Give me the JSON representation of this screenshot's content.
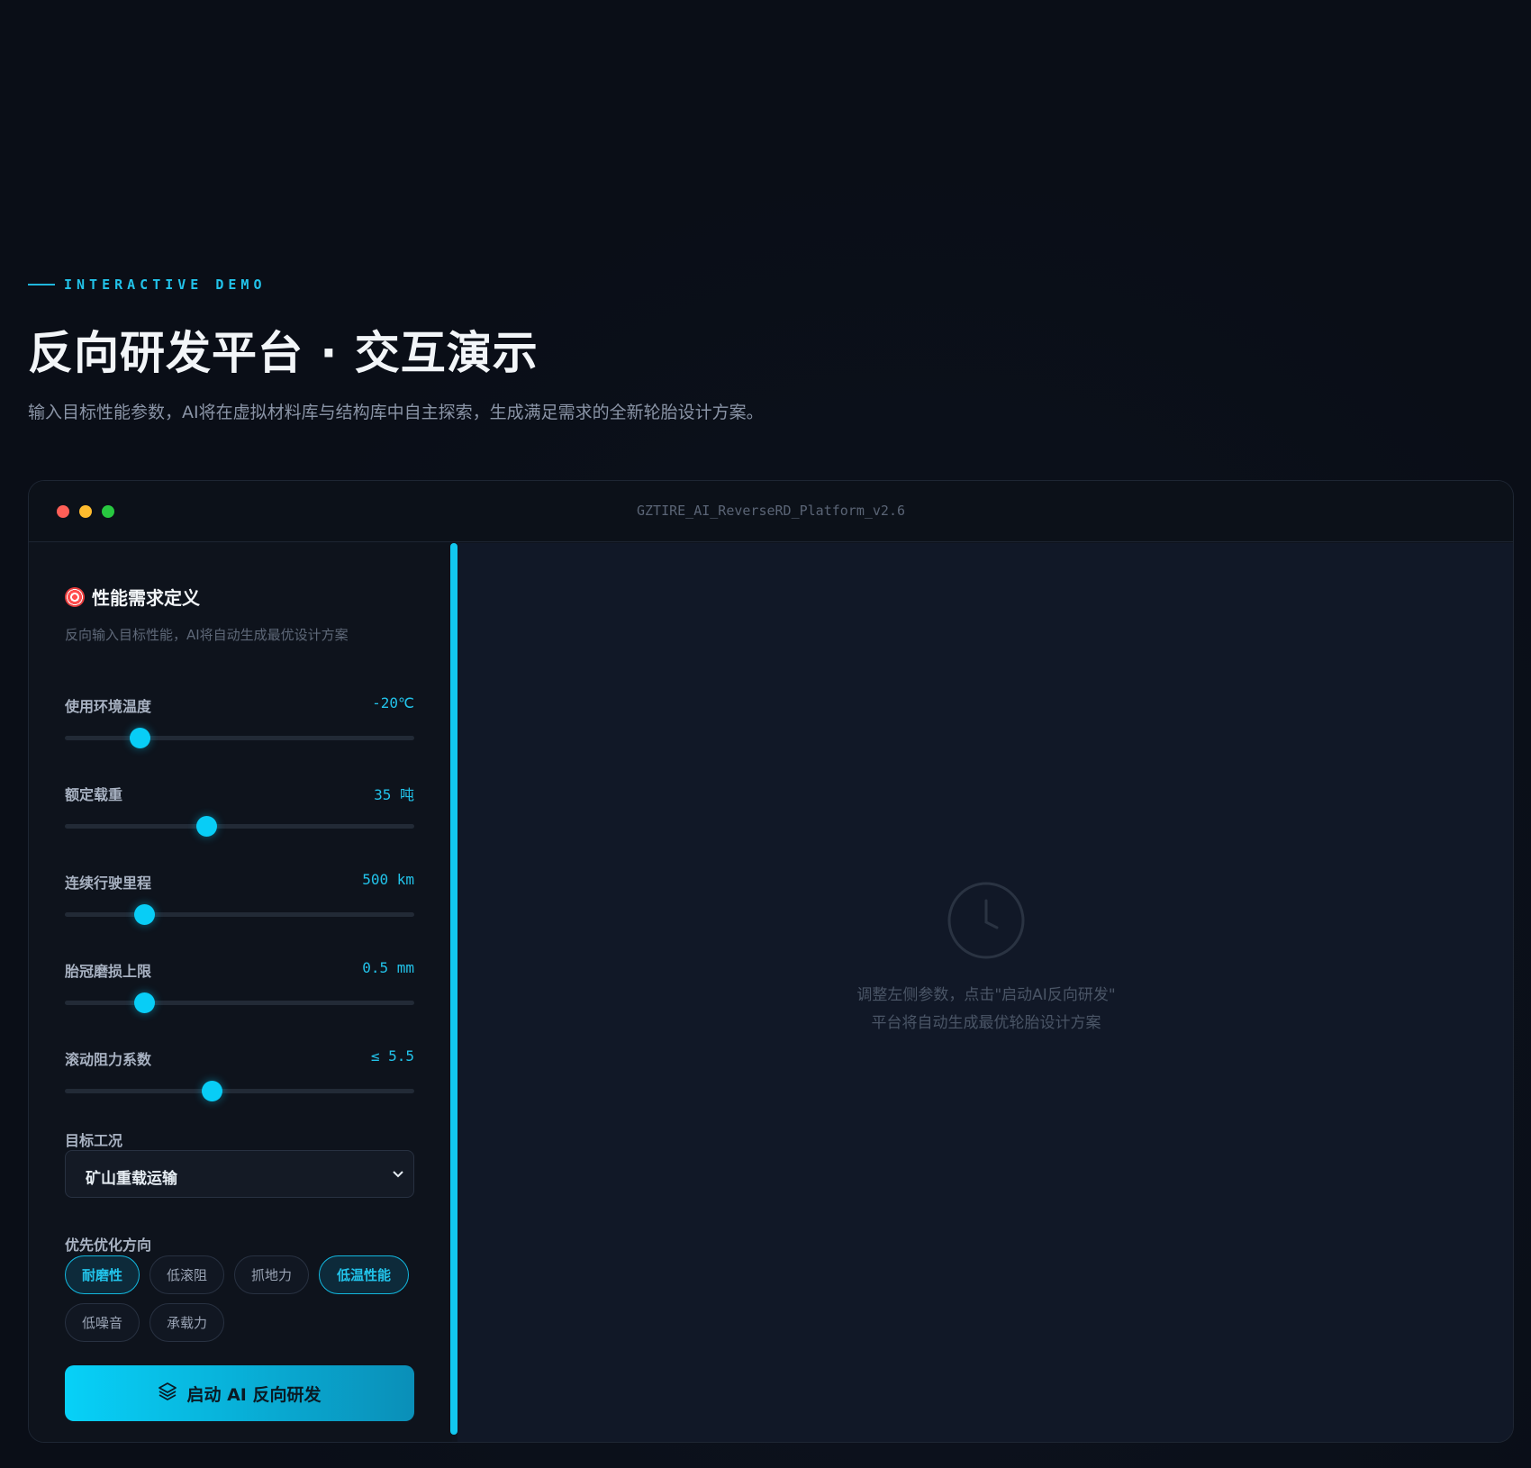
{
  "header": {
    "eyebrow": "INTERACTIVE DEMO",
    "title": "反向研发平台 · 交互演示",
    "subtitle": "输入目标性能参数，AI将在虚拟材料库与结构库中自主探索，生成满足需求的全新轮胎设计方案。"
  },
  "window": {
    "title": "GZTIRE_AI_ReverseRD_Platform_v2.6"
  },
  "left_panel": {
    "title": "性能需求定义",
    "description": "反向输入目标性能，AI将自动生成最优设计方案",
    "sliders": [
      {
        "label": "使用环境温度",
        "value": "-20℃",
        "position": 0.215
      },
      {
        "label": "额定载重",
        "value": "35 吨",
        "position": 0.404
      },
      {
        "label": "连续行驶里程",
        "value": "500 km",
        "position": 0.226
      },
      {
        "label": "胎冠磨损上限",
        "value": "0.5 mm",
        "position": 0.226
      },
      {
        "label": "滚动阻力系数",
        "value": "≤ 5.5",
        "position": 0.421
      }
    ],
    "condition": {
      "label": "目标工况",
      "selected": "矿山重载运输"
    },
    "priority": {
      "label": "优先优化方向",
      "chips": [
        {
          "label": "耐磨性",
          "active": true
        },
        {
          "label": "低滚阻",
          "active": false
        },
        {
          "label": "抓地力",
          "active": false
        },
        {
          "label": "低温性能",
          "active": true
        },
        {
          "label": "低噪音",
          "active": false
        },
        {
          "label": "承载力",
          "active": false
        }
      ]
    },
    "launch_button": "启动 AI 反向研发"
  },
  "right_panel": {
    "placeholder_line1": "调整左侧参数，点击\"启动AI反向研发\"",
    "placeholder_line2": "平台将自动生成最优轮胎设计方案"
  },
  "colors": {
    "accent": "#22c3ea",
    "background": "#0a0e17"
  }
}
